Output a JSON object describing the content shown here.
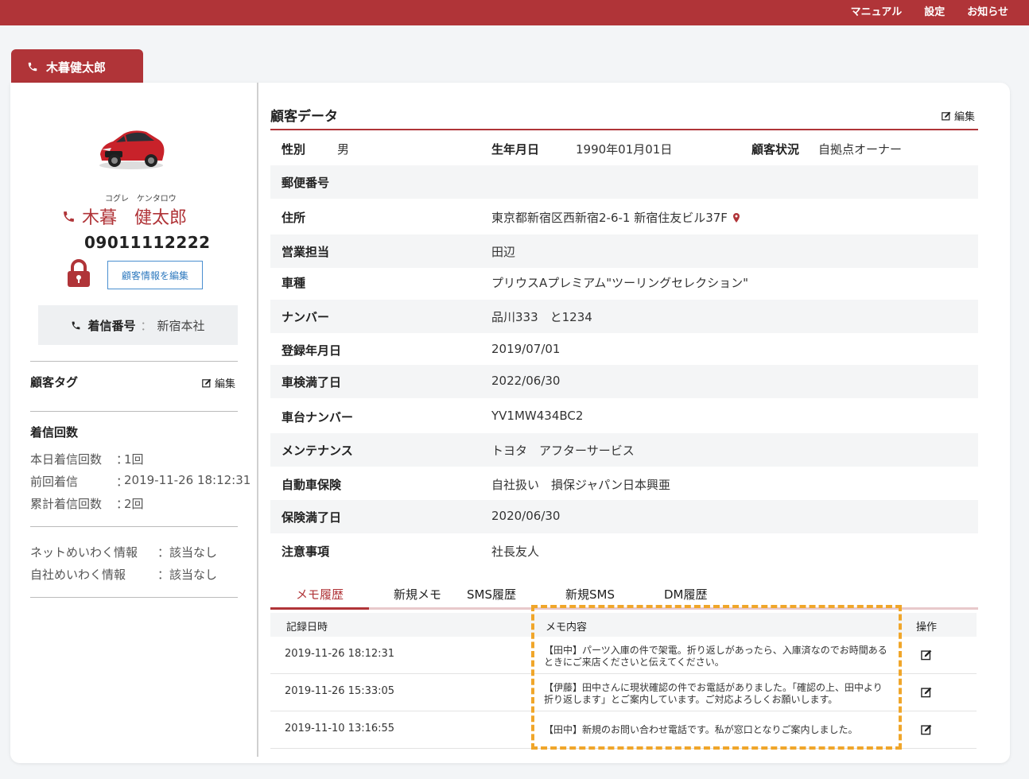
{
  "topnav": {
    "manual": "マニュアル",
    "settings": "設定",
    "notices": "お知らせ"
  },
  "caller_tab": {
    "name": "木暮健太郎"
  },
  "profile": {
    "kana": "コグレ　ケンタロウ",
    "name": "木暮　健太郎",
    "phone": "09011112222",
    "edit_button": "顧客情報を編集",
    "incoming_label": "着信番号",
    "incoming_sep": "：",
    "incoming_value": "新宿本社"
  },
  "tags": {
    "title": "顧客タグ",
    "edit": "編集"
  },
  "calls": {
    "title": "着信回数",
    "rows": [
      {
        "label": "本日着信回数",
        "colon": "：",
        "value": "1回"
      },
      {
        "label": "前回着信",
        "colon": "：",
        "value": "2019-11-26 18:12:31"
      },
      {
        "label": "累計着信回数",
        "colon": "：",
        "value": "2回"
      }
    ]
  },
  "meiwaku": [
    {
      "label": "ネットめいわく情報",
      "value": "：該当なし"
    },
    {
      "label": "自社めいわく情報",
      "value": "：該当なし"
    }
  ],
  "customer": {
    "title": "顧客データ",
    "edit": "編集",
    "gender_label": "性別",
    "gender": "男",
    "birth_label": "生年月日",
    "birth": "1990年01月01日",
    "status_label": "顧客状況",
    "status": "自拠点オーナー",
    "rows": [
      {
        "label": "郵便番号",
        "value": ""
      },
      {
        "label": "住所",
        "value": "東京都新宿区西新宿2-6-1 新宿住友ビル37F"
      },
      {
        "label": "営業担当",
        "value": "田辺"
      },
      {
        "label": "車種",
        "value": "プリウスAプレミアム\"ツーリングセレクション\""
      },
      {
        "label": "ナンバー",
        "value": "品川333　と1234"
      },
      {
        "label": "登録年月日",
        "value": "2019/07/01"
      },
      {
        "label": "車検満了日",
        "value": "2022/06/30"
      },
      {
        "label": "車台ナンバー",
        "value": "YV1MW434BC2"
      },
      {
        "label": "メンテナンス",
        "value": "トヨタ　アフターサービス"
      },
      {
        "label": "自動車保険",
        "value": "自社扱い　損保ジャパン日本興亜"
      },
      {
        "label": "保険満了日",
        "value": "2020/06/30"
      },
      {
        "label": "注意事項",
        "value": "社長友人"
      }
    ]
  },
  "tabs": [
    "メモ履歴",
    "新規メモ",
    "SMS履歴",
    "新規SMS",
    "DM履歴"
  ],
  "memo_table": {
    "headers": {
      "date": "記録日時",
      "content": "メモ内容",
      "action": "操作"
    },
    "rows": [
      {
        "date": "2019-11-26 18:12:31",
        "content": "【田中】パーツ入庫の件で架電。折り返しがあったら、入庫済なのでお時間あるときにご来店くださいと伝えてください。"
      },
      {
        "date": "2019-11-26 15:33:05",
        "content": "【伊藤】田中さんに現状確認の件でお電話がありました。「確認の上、田中より折り返します」とご案内しています。ご対応よろしくお願いします。"
      },
      {
        "date": "2019-11-10 13:16:55",
        "content": "【田中】新規のお問い合わせ電話です。私が窓口となりご案内しました。"
      }
    ]
  },
  "colors": {
    "brand": "#b03438",
    "highlight": "#f0a62a",
    "link": "#2f7abf"
  }
}
